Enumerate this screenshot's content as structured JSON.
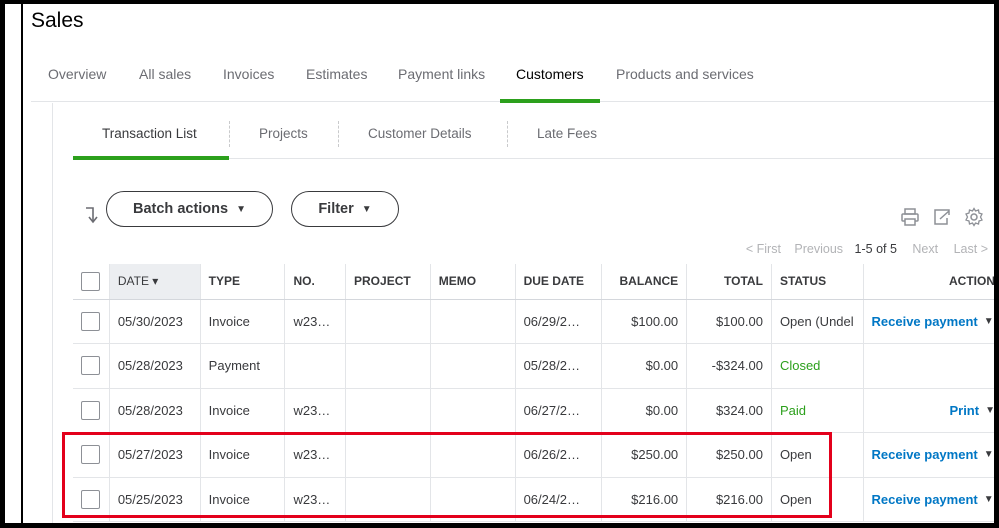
{
  "page_title": "Sales",
  "main_tabs": [
    {
      "label": "Overview",
      "active": false
    },
    {
      "label": "All sales",
      "active": false
    },
    {
      "label": "Invoices",
      "active": false
    },
    {
      "label": "Estimates",
      "active": false
    },
    {
      "label": "Payment links",
      "active": false
    },
    {
      "label": "Customers",
      "active": true
    },
    {
      "label": "Products and services",
      "active": false
    }
  ],
  "sub_tabs": [
    {
      "label": "Transaction List",
      "active": true
    },
    {
      "label": "Projects",
      "active": false
    },
    {
      "label": "Customer Details",
      "active": false
    },
    {
      "label": "Late Fees",
      "active": false
    }
  ],
  "toolbar": {
    "batch_actions_label": "Batch actions",
    "filter_label": "Filter"
  },
  "pager": {
    "first": "< First",
    "previous": "Previous",
    "range": "1-5 of 5",
    "next": "Next",
    "last": "Last >"
  },
  "table": {
    "columns": [
      "DATE ▾",
      "TYPE",
      "NO.",
      "PROJECT",
      "MEMO",
      "DUE DATE",
      "BALANCE",
      "TOTAL",
      "STATUS",
      "ACTION"
    ],
    "rows": [
      {
        "date": "05/30/2023",
        "type": "Invoice",
        "no": "w23…",
        "project": "",
        "memo": "",
        "due_date": "06/29/2…",
        "balance": "$100.00",
        "total": "$100.00",
        "status": "Open (Undel",
        "action": "Receive payment"
      },
      {
        "date": "05/28/2023",
        "type": "Payment",
        "no": "",
        "project": "",
        "memo": "",
        "due_date": "05/28/2…",
        "balance": "$0.00",
        "total": "-$324.00",
        "status": "Closed",
        "action": ""
      },
      {
        "date": "05/28/2023",
        "type": "Invoice",
        "no": "w23…",
        "project": "",
        "memo": "",
        "due_date": "06/27/2…",
        "balance": "$0.00",
        "total": "$324.00",
        "status": "Paid",
        "action": "Print"
      },
      {
        "date": "05/27/2023",
        "type": "Invoice",
        "no": "w23…",
        "project": "",
        "memo": "",
        "due_date": "06/26/2…",
        "balance": "$250.00",
        "total": "$250.00",
        "status": "Open",
        "action": "Receive payment"
      },
      {
        "date": "05/25/2023",
        "type": "Invoice",
        "no": "w23…",
        "project": "",
        "memo": "",
        "due_date": "06/24/2…",
        "balance": "$216.00",
        "total": "$216.00",
        "status": "Open",
        "action": "Receive payment"
      }
    ]
  },
  "colors": {
    "accent_green": "#2ca01c",
    "link_blue": "#0077c5",
    "highlight_red": "#e3001b"
  },
  "icons": [
    "sort-icon",
    "print-icon",
    "export-icon",
    "gear-icon",
    "chevron-down-icon"
  ]
}
